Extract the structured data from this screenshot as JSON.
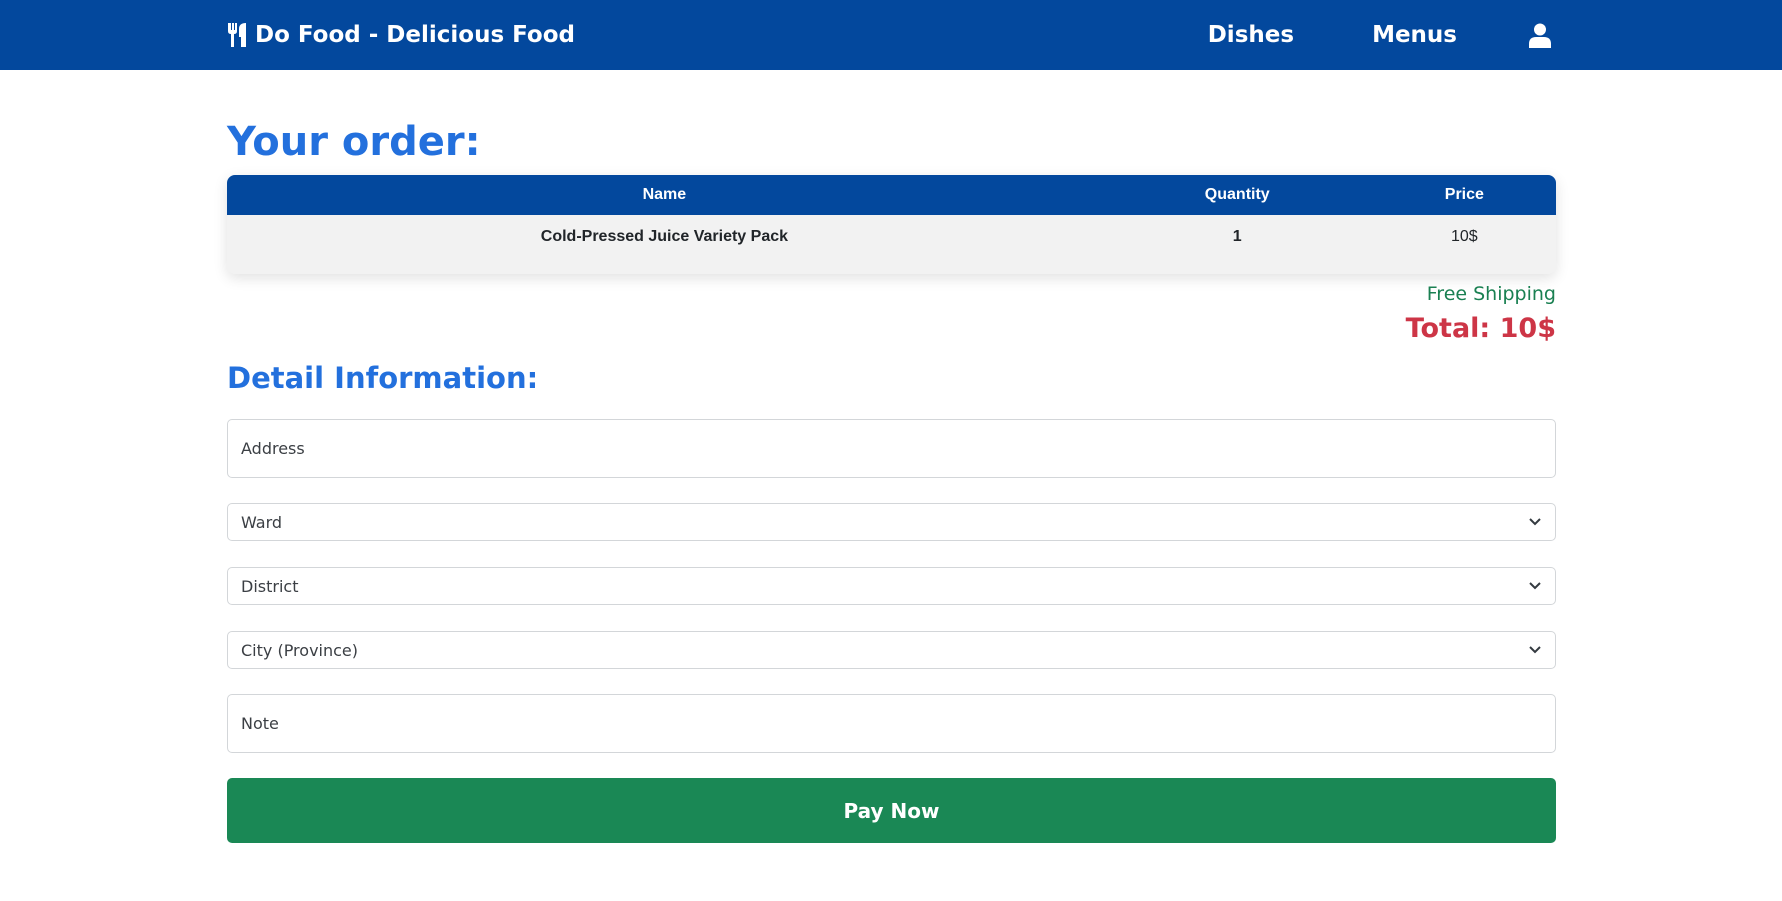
{
  "brand": {
    "name": "Do Food - Delicious Food",
    "icon": "utensils-icon"
  },
  "nav": {
    "dishes": "Dishes",
    "menus": "Menus",
    "user_icon": "user-icon"
  },
  "order": {
    "title": "Your order:",
    "columns": [
      "Name",
      "Quantity",
      "Price"
    ],
    "rows": [
      {
        "name": "Cold-Pressed Juice Variety Pack",
        "quantity": "1",
        "price": "10$"
      }
    ],
    "shipping": "Free Shipping",
    "total": "Total: 10$"
  },
  "details": {
    "title": "Detail Information:",
    "address_placeholder": "Address",
    "ward": "Ward",
    "district": "District",
    "city": "City (Province)",
    "note_placeholder": "Note"
  },
  "pay_label": "Pay Now",
  "colors": {
    "navbar": "#03489d",
    "heading": "#2370dd",
    "shipping": "#1a8052",
    "total": "#cd3546",
    "pay_button": "#1a8855"
  }
}
